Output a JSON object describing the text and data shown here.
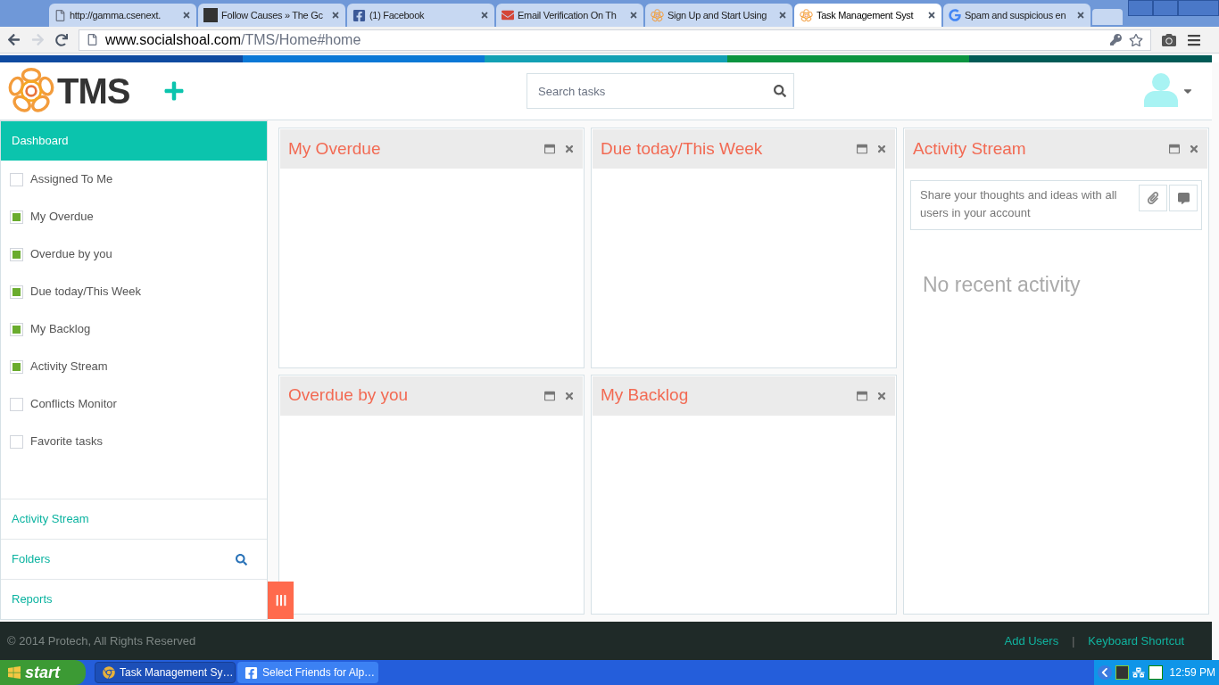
{
  "browser": {
    "tabs": [
      {
        "title": "http://gamma.csenext.",
        "kind": "page",
        "selected": false
      },
      {
        "title": "Follow Causes » The Gc",
        "kind": "pf",
        "selected": false
      },
      {
        "title": "(1) Facebook",
        "kind": "facebook",
        "selected": false
      },
      {
        "title": "Email Verification On Th",
        "kind": "gmail",
        "selected": false
      },
      {
        "title": "Sign Up and Start Using",
        "kind": "flower",
        "selected": false
      },
      {
        "title": "Task Management Syst",
        "kind": "flower",
        "selected": true
      },
      {
        "title": "Spam and suspicious en",
        "kind": "google",
        "selected": false
      }
    ],
    "url_host": "www.socialshoal.com",
    "url_path": "/TMS/Home#home"
  },
  "header": {
    "logo_text": "TMS",
    "search": {
      "placeholder": "Search tasks"
    }
  },
  "sidebar": {
    "heading": {
      "label": "Dashboard",
      "selected": true
    },
    "items": [
      {
        "label": "Assigned To Me",
        "checked": false
      },
      {
        "label": "My Overdue",
        "checked": true
      },
      {
        "label": "Overdue by you",
        "checked": true
      },
      {
        "label": "Due today/This Week",
        "checked": true
      },
      {
        "label": "My Backlog",
        "checked": true
      },
      {
        "label": "Activity Stream",
        "checked": true
      },
      {
        "label": "Conflicts Monitor",
        "checked": false
      },
      {
        "label": "Favorite tasks",
        "checked": false
      }
    ],
    "links": [
      {
        "label": "Activity Stream",
        "search": false
      },
      {
        "label": "Folders",
        "search": true
      },
      {
        "label": "Reports",
        "search": false
      }
    ]
  },
  "widgets": [
    {
      "title": "My Overdue"
    },
    {
      "title": "Due today/This Week"
    },
    {
      "title": "Overdue by you"
    },
    {
      "title": "My Backlog"
    }
  ],
  "activity": {
    "title": "Activity Stream",
    "composer_placeholder": "Share your thoughts and ideas with all users in your account",
    "empty": "No recent activity"
  },
  "footer": {
    "copyright": "© 2014 Protech, All Rights Reserved",
    "links": [
      "Add Users",
      "Keyboard Shortcut"
    ],
    "separator": "|"
  },
  "taskbar": {
    "start": "start",
    "windows": [
      {
        "title": "Task Management Sy…",
        "kind": "chrome",
        "selected": true
      },
      {
        "title": "Select Friends for Alp…",
        "kind": "facebook",
        "selected": false
      }
    ],
    "clock": "12:59 PM"
  }
}
